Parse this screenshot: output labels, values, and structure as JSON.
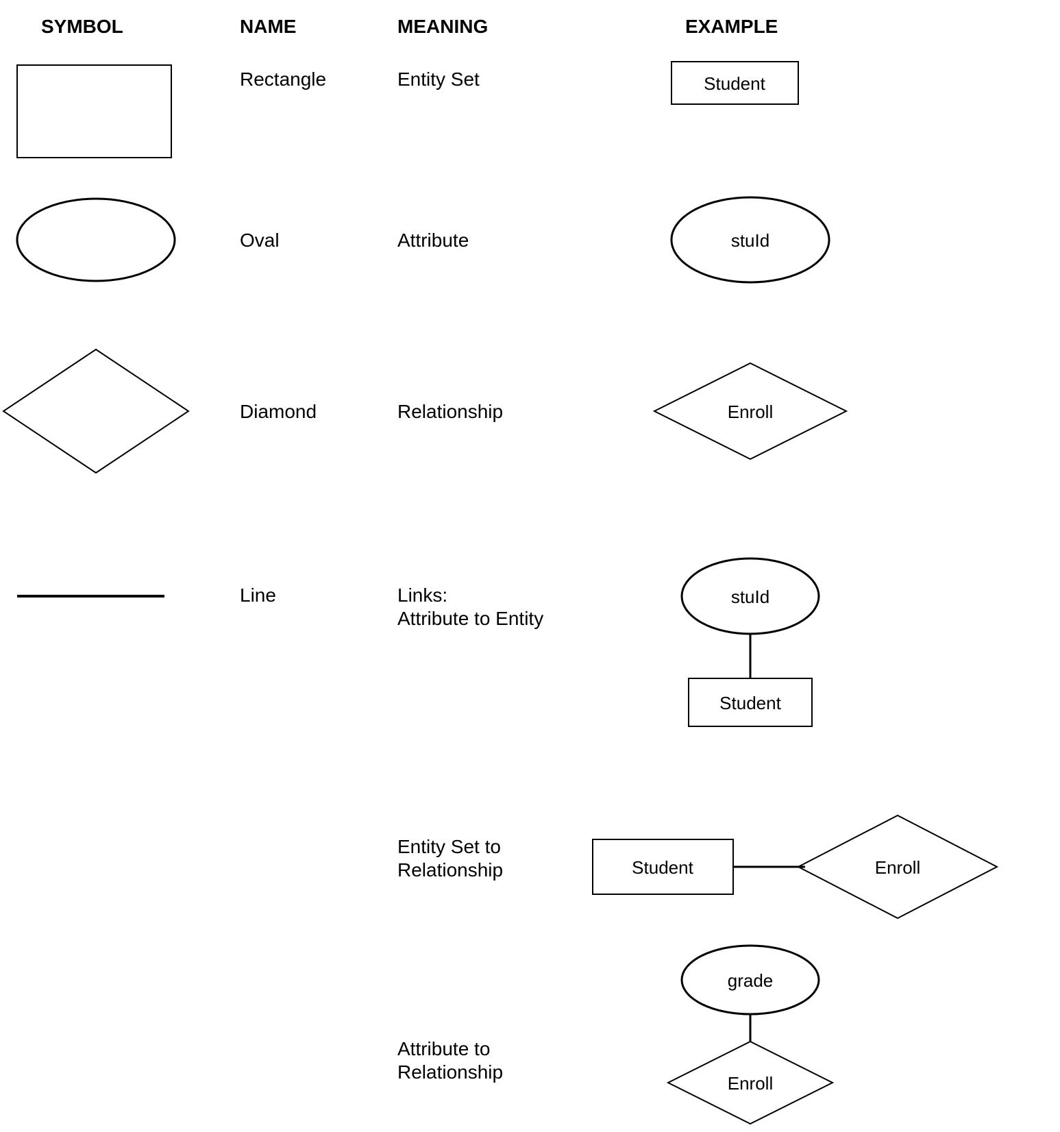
{
  "headers": {
    "symbol": "SYMBOL",
    "name": "NAME",
    "meaning": "MEANING",
    "example": "EXAMPLE"
  },
  "rows": [
    {
      "name": "Rectangle",
      "meaning": "Entity Set",
      "example_label": "Student"
    },
    {
      "name": "Oval",
      "meaning": "Attribute",
      "example_label": "stuId"
    },
    {
      "name": "Diamond",
      "meaning": "Relationship",
      "example_label": "Enroll"
    },
    {
      "name": "Line",
      "meaning": "Links:\nAttribute to Entity",
      "example_top_label": "stuId",
      "example_bottom_label": "Student"
    }
  ],
  "sub_rows": [
    {
      "meaning": "Entity Set to\nRelationship",
      "left_label": "Student",
      "right_label": "Enroll"
    },
    {
      "meaning": "Attribute to\nRelationship",
      "top_label": "grade",
      "bottom_label": "Enroll"
    }
  ]
}
